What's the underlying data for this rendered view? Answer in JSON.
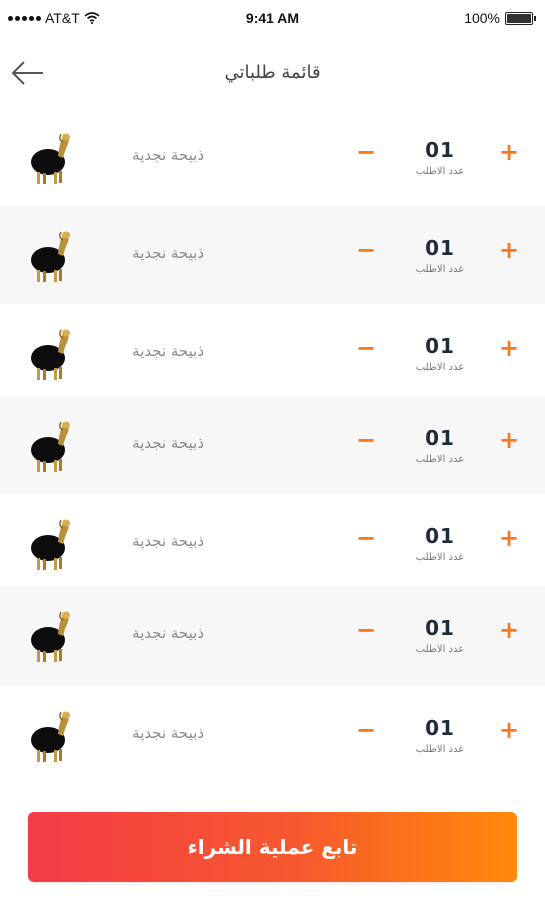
{
  "status_bar": {
    "carrier": "AT&T",
    "time": "9:41 AM",
    "battery": "100%",
    "battery_level": 1.0
  },
  "header": {
    "title": "قائمة طلباتي"
  },
  "items": [
    {
      "name": "ذبيحة نجدية",
      "quantity": "01",
      "quantity_label": "عدد الاطلب"
    },
    {
      "name": "ذبيحة نجدية",
      "quantity": "01",
      "quantity_label": "عدد الاطلب"
    },
    {
      "name": "ذبيحة نجدية",
      "quantity": "01",
      "quantity_label": "عدد الاطلب"
    },
    {
      "name": "ذبيحة نجدية",
      "quantity": "01",
      "quantity_label": "عدد الاطلب"
    },
    {
      "name": "ذبيحة نجدية",
      "quantity": "01",
      "quantity_label": "عدد الاطلب"
    },
    {
      "name": "ذبيحة نجدية",
      "quantity": "01",
      "quantity_label": "عدد الاطلب"
    },
    {
      "name": "ذبيحة نجدية",
      "quantity": "01",
      "quantity_label": "عدد الاطلب"
    }
  ],
  "controls": {
    "minus": "−",
    "plus": "+"
  },
  "checkout": {
    "label": "تابع عملية الشراء"
  },
  "colors": {
    "accent": "#f47a1f",
    "button_start": "#f33b46",
    "button_end": "#ff8a0a"
  }
}
